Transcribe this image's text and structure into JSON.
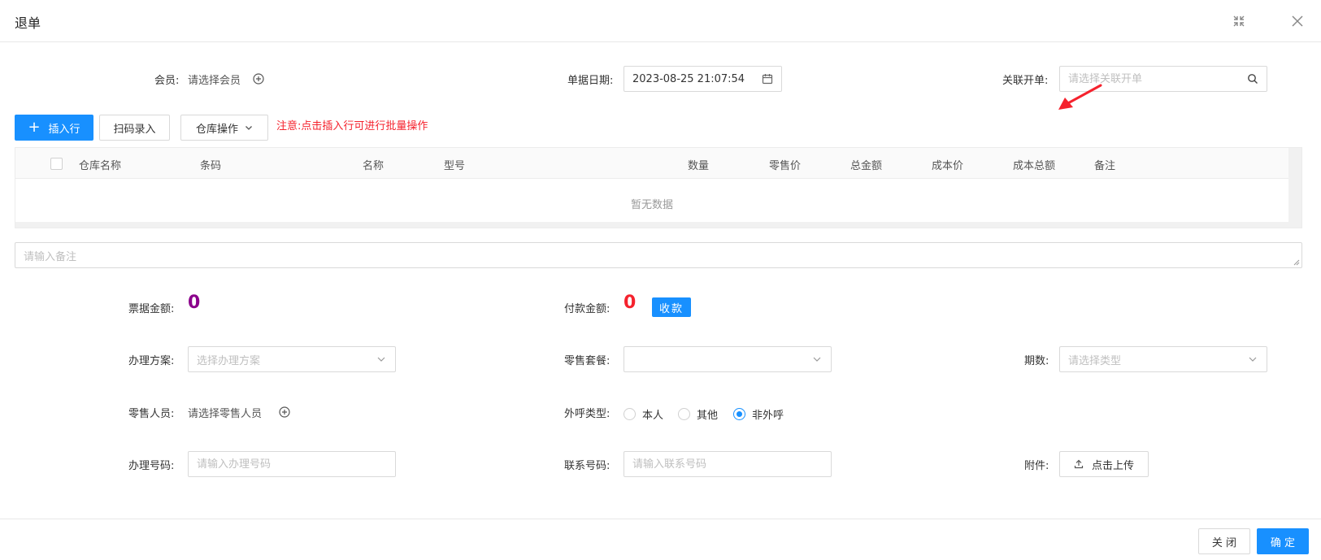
{
  "dialog": {
    "title": "退单"
  },
  "top_form": {
    "member_label": "会员:",
    "member_value": "请选择会员",
    "date_label": "单据日期:",
    "date_value": "2023-08-25 21:07:54",
    "link_label": "关联开单:",
    "link_placeholder": "请选择关联开单"
  },
  "toolbar": {
    "insert_label": "插入行",
    "scan_label": "扫码录入",
    "warehouse_label": "仓库操作",
    "note": "注意:点击插入行可进行批量操作"
  },
  "table": {
    "columns": [
      "仓库名称",
      "条码",
      "名称",
      "型号",
      "数量",
      "零售价",
      "总金额",
      "成本价",
      "成本总额",
      "备注"
    ],
    "empty_text": "暂无数据"
  },
  "remark": {
    "placeholder": "请输入备注"
  },
  "amounts": {
    "bill_label": "票据金额:",
    "bill_value": "0",
    "bill_color": "#8b008b",
    "pay_label": "付款金额:",
    "pay_value": "0",
    "pay_color": "#f5222d",
    "collect_label": "收款"
  },
  "form": {
    "plan_label": "办理方案:",
    "plan_placeholder": "选择办理方案",
    "package_label": "零售套餐:",
    "package_value": "",
    "period_label": "期数:",
    "period_placeholder": "请选择类型",
    "staff_label": "零售人员:",
    "staff_value": "请选择零售人员",
    "call_type_label": "外呼类型:",
    "call_types": [
      "本人",
      "其他",
      "非外呼"
    ],
    "call_type_selected": "非外呼",
    "number_label": "办理号码:",
    "number_placeholder": "请输入办理号码",
    "contact_label": "联系号码:",
    "contact_placeholder": "请输入联系号码",
    "attach_label": "附件:",
    "upload_label": "点击上传"
  },
  "footer": {
    "close_label": "关 闭",
    "confirm_label": "确 定"
  },
  "colors": {
    "primary": "#1890ff",
    "warning": "#f5222d"
  }
}
